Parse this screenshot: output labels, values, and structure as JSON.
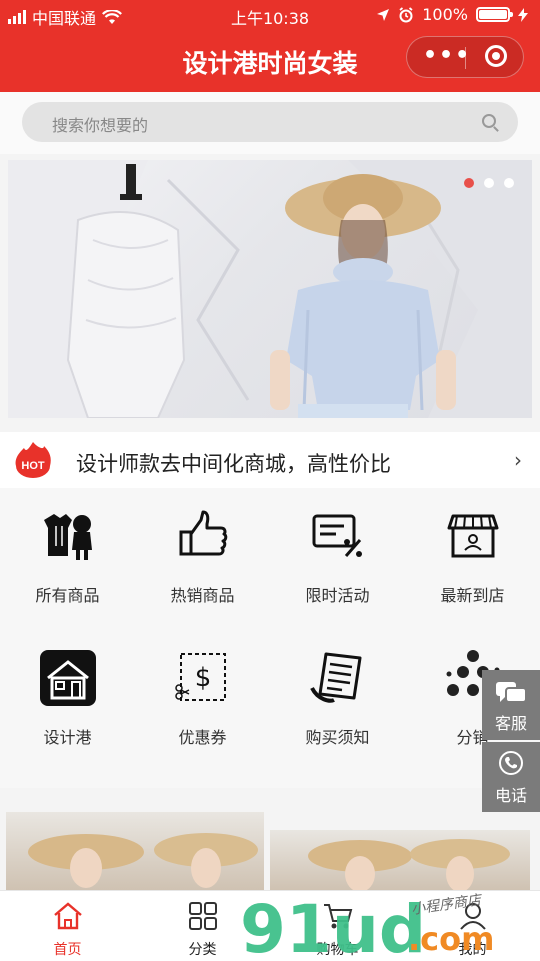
{
  "status_bar": {
    "carrier": "中国联通",
    "time": "上午10:38",
    "battery": "100%",
    "battery_level": 1.0
  },
  "navbar": {
    "title": "设计港时尚女装",
    "more_icon": "more-dots-icon",
    "close_icon": "target-icon"
  },
  "search": {
    "placeholder": "搜索你想要的",
    "icon": "search-icon"
  },
  "banner": {
    "slide_count": 3,
    "active_slide": 1
  },
  "notice": {
    "badge": "HOT",
    "text": "设计师款去中间化商城，高性价比",
    "arrow": "›"
  },
  "grid": {
    "items": [
      {
        "label": "所有商品",
        "icon": "clothing-icon"
      },
      {
        "label": "热销商品",
        "icon": "thumbs-up-icon"
      },
      {
        "label": "限时活动",
        "icon": "discount-ticket-icon"
      },
      {
        "label": "最新到店",
        "icon": "storefront-icon"
      },
      {
        "label": "设计港",
        "icon": "house-icon"
      },
      {
        "label": "优惠券",
        "icon": "coupon-icon"
      },
      {
        "label": "购买须知",
        "icon": "receipt-icon"
      },
      {
        "label": "分销",
        "icon": "network-icon"
      }
    ]
  },
  "float_buttons": {
    "service": "客服",
    "phone": "电话"
  },
  "tabbar": {
    "items": [
      {
        "label": "首页",
        "icon": "home-icon"
      },
      {
        "label": "分类",
        "icon": "category-grid-icon"
      },
      {
        "label": "购物车",
        "icon": "cart-icon"
      },
      {
        "label": "我的",
        "icon": "user-icon"
      }
    ]
  },
  "watermark": {
    "text": "91ud",
    "domain": ".com",
    "caption": "小程序商店"
  },
  "colors": {
    "brand_red": "#e8322a",
    "watermark_green": "#3fc08a",
    "watermark_orange": "#f08a24"
  }
}
